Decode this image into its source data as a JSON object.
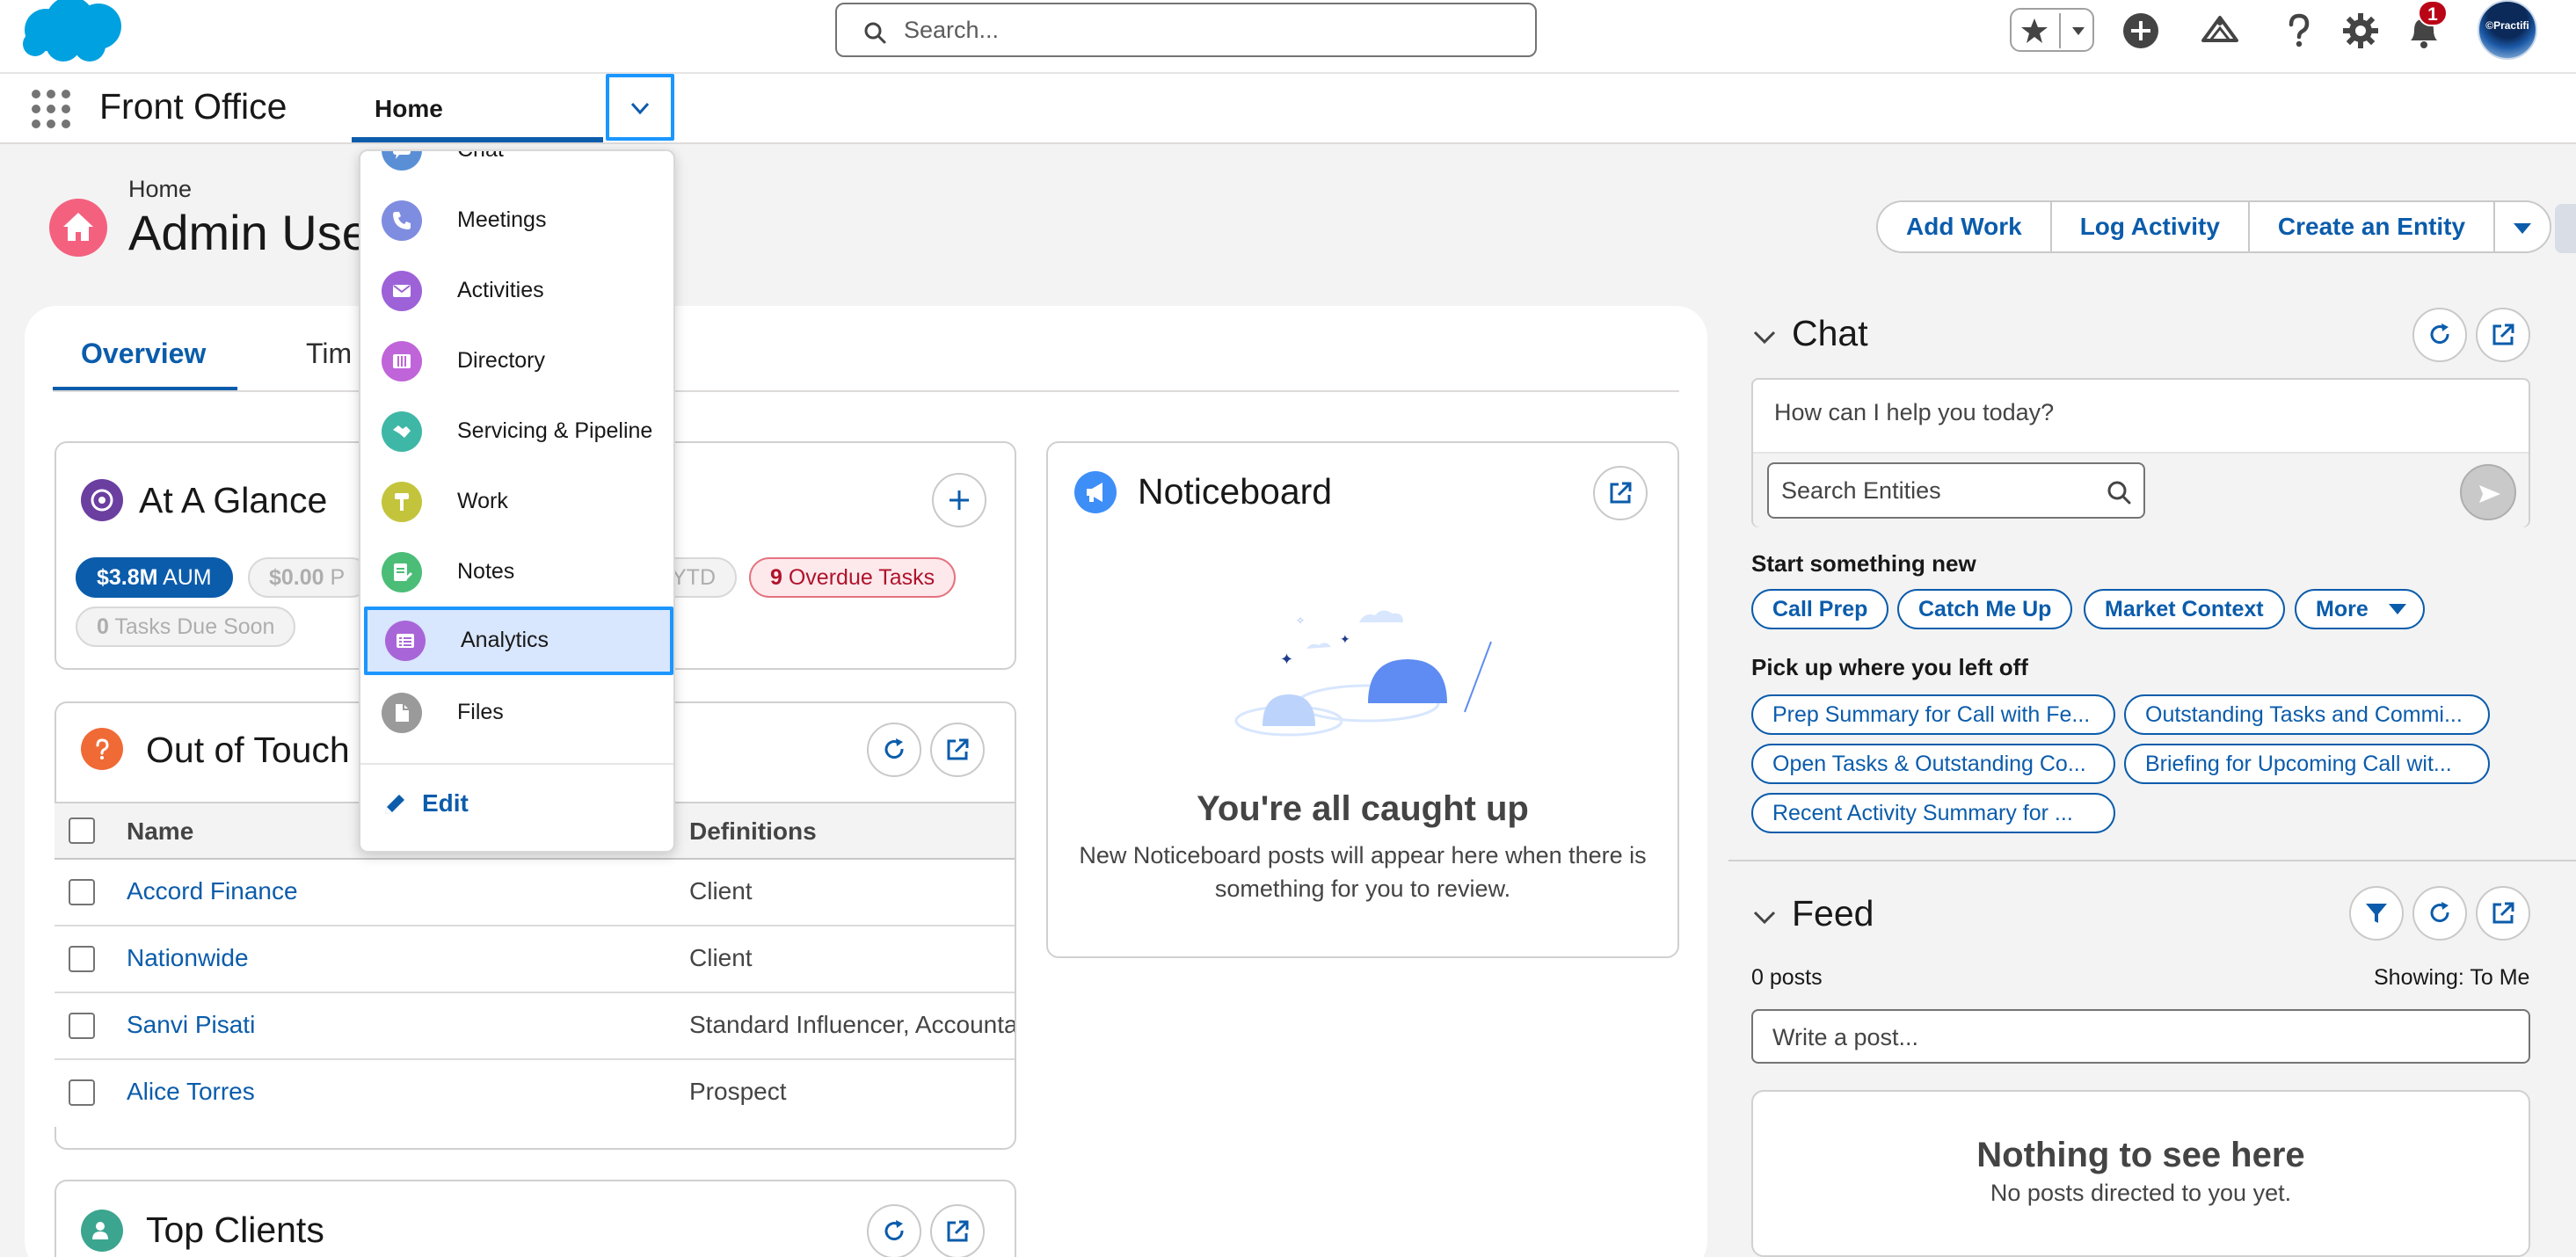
{
  "global_header": {
    "search_placeholder": "Search...",
    "notification_count": "1",
    "avatar_label": "©Practifi"
  },
  "app_nav": {
    "app_name": "Front Office",
    "current_tab": "Home"
  },
  "nav_menu": {
    "items": [
      {
        "label": "Chat",
        "icon": "chat-icon",
        "color": "#5a8fd6"
      },
      {
        "label": "Meetings",
        "icon": "phone-icon",
        "color": "#7f8de1"
      },
      {
        "label": "Activities",
        "icon": "email-icon",
        "color": "#9d62d8"
      },
      {
        "label": "Directory",
        "icon": "book-icon",
        "color": "#c064d9"
      },
      {
        "label": "Servicing & Pipeline",
        "icon": "handshake-icon",
        "color": "#3fb7a6"
      },
      {
        "label": "Work",
        "icon": "hammer-icon",
        "color": "#c3c43c"
      },
      {
        "label": "Notes",
        "icon": "note-icon",
        "color": "#4bbd77"
      },
      {
        "label": "Analytics",
        "icon": "analytics-icon",
        "color": "#a865d8"
      },
      {
        "label": "Files",
        "icon": "file-icon",
        "color": "#9a9a9a"
      }
    ],
    "selected": "Analytics",
    "edit_label": "Edit"
  },
  "page_header": {
    "breadcrumb": "Home",
    "title": "Admin Use",
    "actions": [
      "Add Work",
      "Log Activity",
      "Create an Entity"
    ]
  },
  "tabs": {
    "overview": "Overview",
    "timeline": "Tim"
  },
  "at_a_glance": {
    "title": "At A Glance",
    "aum_value": "$3.8M",
    "aum_label": "AUM",
    "pipeline_value": "$0.00",
    "pipeline_label": "P",
    "ytd_label": "YTD",
    "overdue_count": "9",
    "overdue_label": "Overdue Tasks",
    "due_soon_count": "0",
    "due_soon_label": "Tasks Due Soon"
  },
  "out_of_touch": {
    "title": "Out of Touch",
    "columns": [
      "Name",
      "Definitions"
    ],
    "rows": [
      {
        "name": "Accord Finance",
        "definition": "Client"
      },
      {
        "name": "Nationwide",
        "definition": "Client"
      },
      {
        "name": "Sanvi Pisati",
        "definition": "Standard Influencer, Accountant"
      },
      {
        "name": "Alice Torres",
        "definition": "Prospect"
      }
    ]
  },
  "top_clients": {
    "title": "Top Clients"
  },
  "noticeboard": {
    "title": "Noticeboard",
    "empty_heading": "You're all caught up",
    "empty_text": "New Noticeboard posts will appear here when there is something for you to review."
  },
  "chat": {
    "title": "Chat",
    "prompt": "How can I help you today?",
    "entity_search_placeholder": "Search Entities",
    "start_new_label": "Start something new",
    "start_chips": [
      "Call Prep",
      "Catch Me Up",
      "Market Context",
      "More"
    ],
    "pick_up_label": "Pick up where you left off",
    "recent_chips": [
      "Prep Summary for Call with Fe...",
      "Outstanding Tasks and Commi...",
      "Open Tasks & Outstanding Co...",
      "Briefing for Upcoming Call wit...",
      "Recent Activity Summary for ..."
    ]
  },
  "feed": {
    "title": "Feed",
    "post_count": "0 posts",
    "showing": "Showing: To Me",
    "post_placeholder": "Write a post...",
    "empty_heading": "Nothing to see here",
    "empty_text": "No posts directed to you yet."
  },
  "colors": {
    "brand_blue": "#0b5cab",
    "focus_blue": "#1b96ff",
    "salesforce_cloud": "#00a1e0",
    "overdue_red": "#b0132b"
  }
}
